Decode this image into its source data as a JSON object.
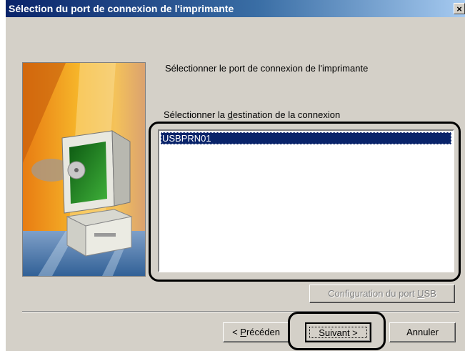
{
  "window": {
    "title": "Sélection du port de connexion de l'imprimante",
    "close_label": "×"
  },
  "main": {
    "heading": "Sélectionner le port de connexion de l'imprimante",
    "destination_label_before": "Sélectionner la ",
    "destination_label_accel": "d",
    "destination_label_after": "estination de la connexion",
    "list_items": [
      "USBPRN01"
    ],
    "selected_index": 0
  },
  "buttons": {
    "usb_config_before": "Configuration du port ",
    "usb_config_accel": "U",
    "usb_config_after": "SB",
    "usb_config_enabled": false,
    "back_before": "< ",
    "back_accel": "P",
    "back_after": "récéden",
    "next_label": "Suivant >",
    "cancel_label": "Annuler"
  }
}
